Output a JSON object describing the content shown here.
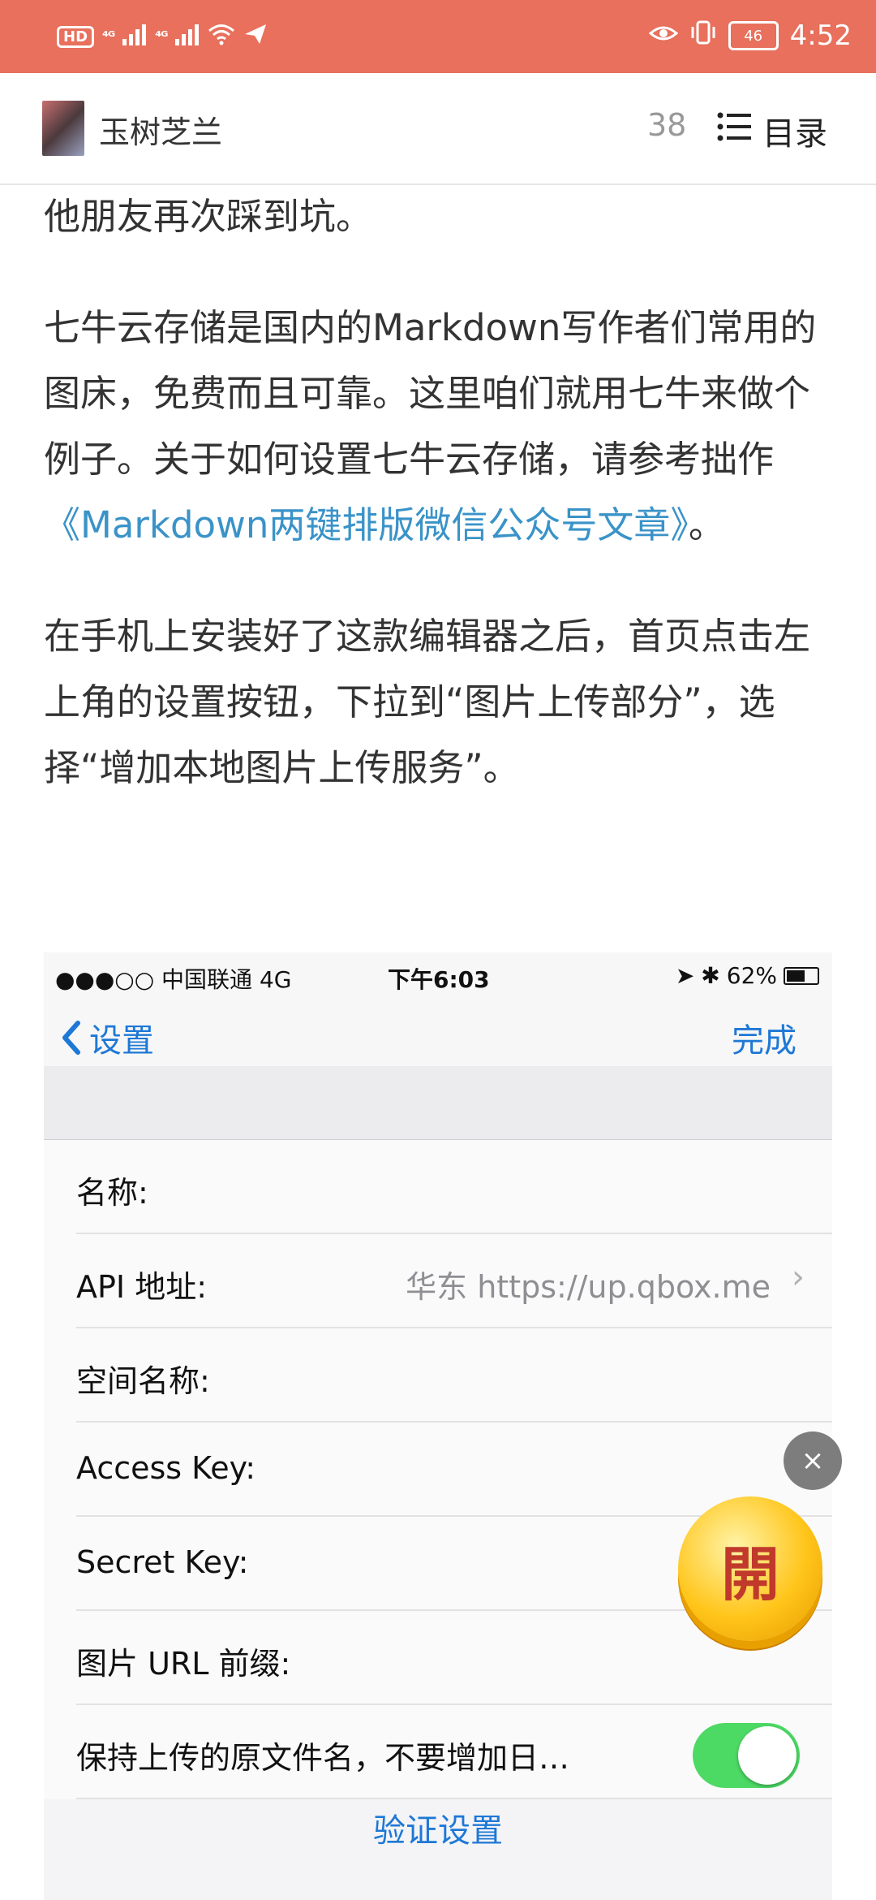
{
  "status_bar": {
    "hd_badge": "HD",
    "signal1": "⁴ᴳ",
    "signal2": "⁴ᴳ",
    "battery": "46",
    "time": "4:52"
  },
  "header": {
    "author": "玉树芝兰",
    "count": "38",
    "toc_label": "目录"
  },
  "article": {
    "p1": "他朋友再次踩到坑。",
    "p2_text": "七牛云存储是国内的Markdown写作者们常用的图床，免费而且可靠。这里咱们就用七牛来做个例子。关于如何设置七牛云存储，请参考拙作",
    "p2_link": "《Markdown两键排版微信公众号文章》",
    "p2_end": "。",
    "p3": "在手机上安装好了这款编辑器之后，首页点击左上角的设置按钮，下拉到“图片上传部分”，选择“增加本地图片上传服务”。"
  },
  "screenshot": {
    "status_left": "●●●○○ 中国联通   4G",
    "status_time": "下午6:03",
    "status_battery": "62%",
    "back_label": "设置",
    "done_label": "完成",
    "rows": [
      {
        "label": "名称:",
        "value": ""
      },
      {
        "label": "API 地址:",
        "value": "华东 https://up.qbox.me"
      },
      {
        "label": "空间名称:",
        "value": ""
      },
      {
        "label": "Access Key:",
        "value": ""
      },
      {
        "label": "Secret Key:",
        "value": ""
      },
      {
        "label": "图片 URL 前缀:",
        "value": ""
      },
      {
        "label": "保持上传的原文件名，不要增加日…",
        "value": ""
      }
    ],
    "verify_label": "验证设置",
    "colors": {
      "accent": "#1e78d6",
      "switch_on": "#4CD964"
    }
  },
  "floating": {
    "close_symbol": "×",
    "open_char": "開"
  },
  "theme": {
    "status_bar_bg": "#E8705C",
    "link_color": "#3A93C8"
  }
}
